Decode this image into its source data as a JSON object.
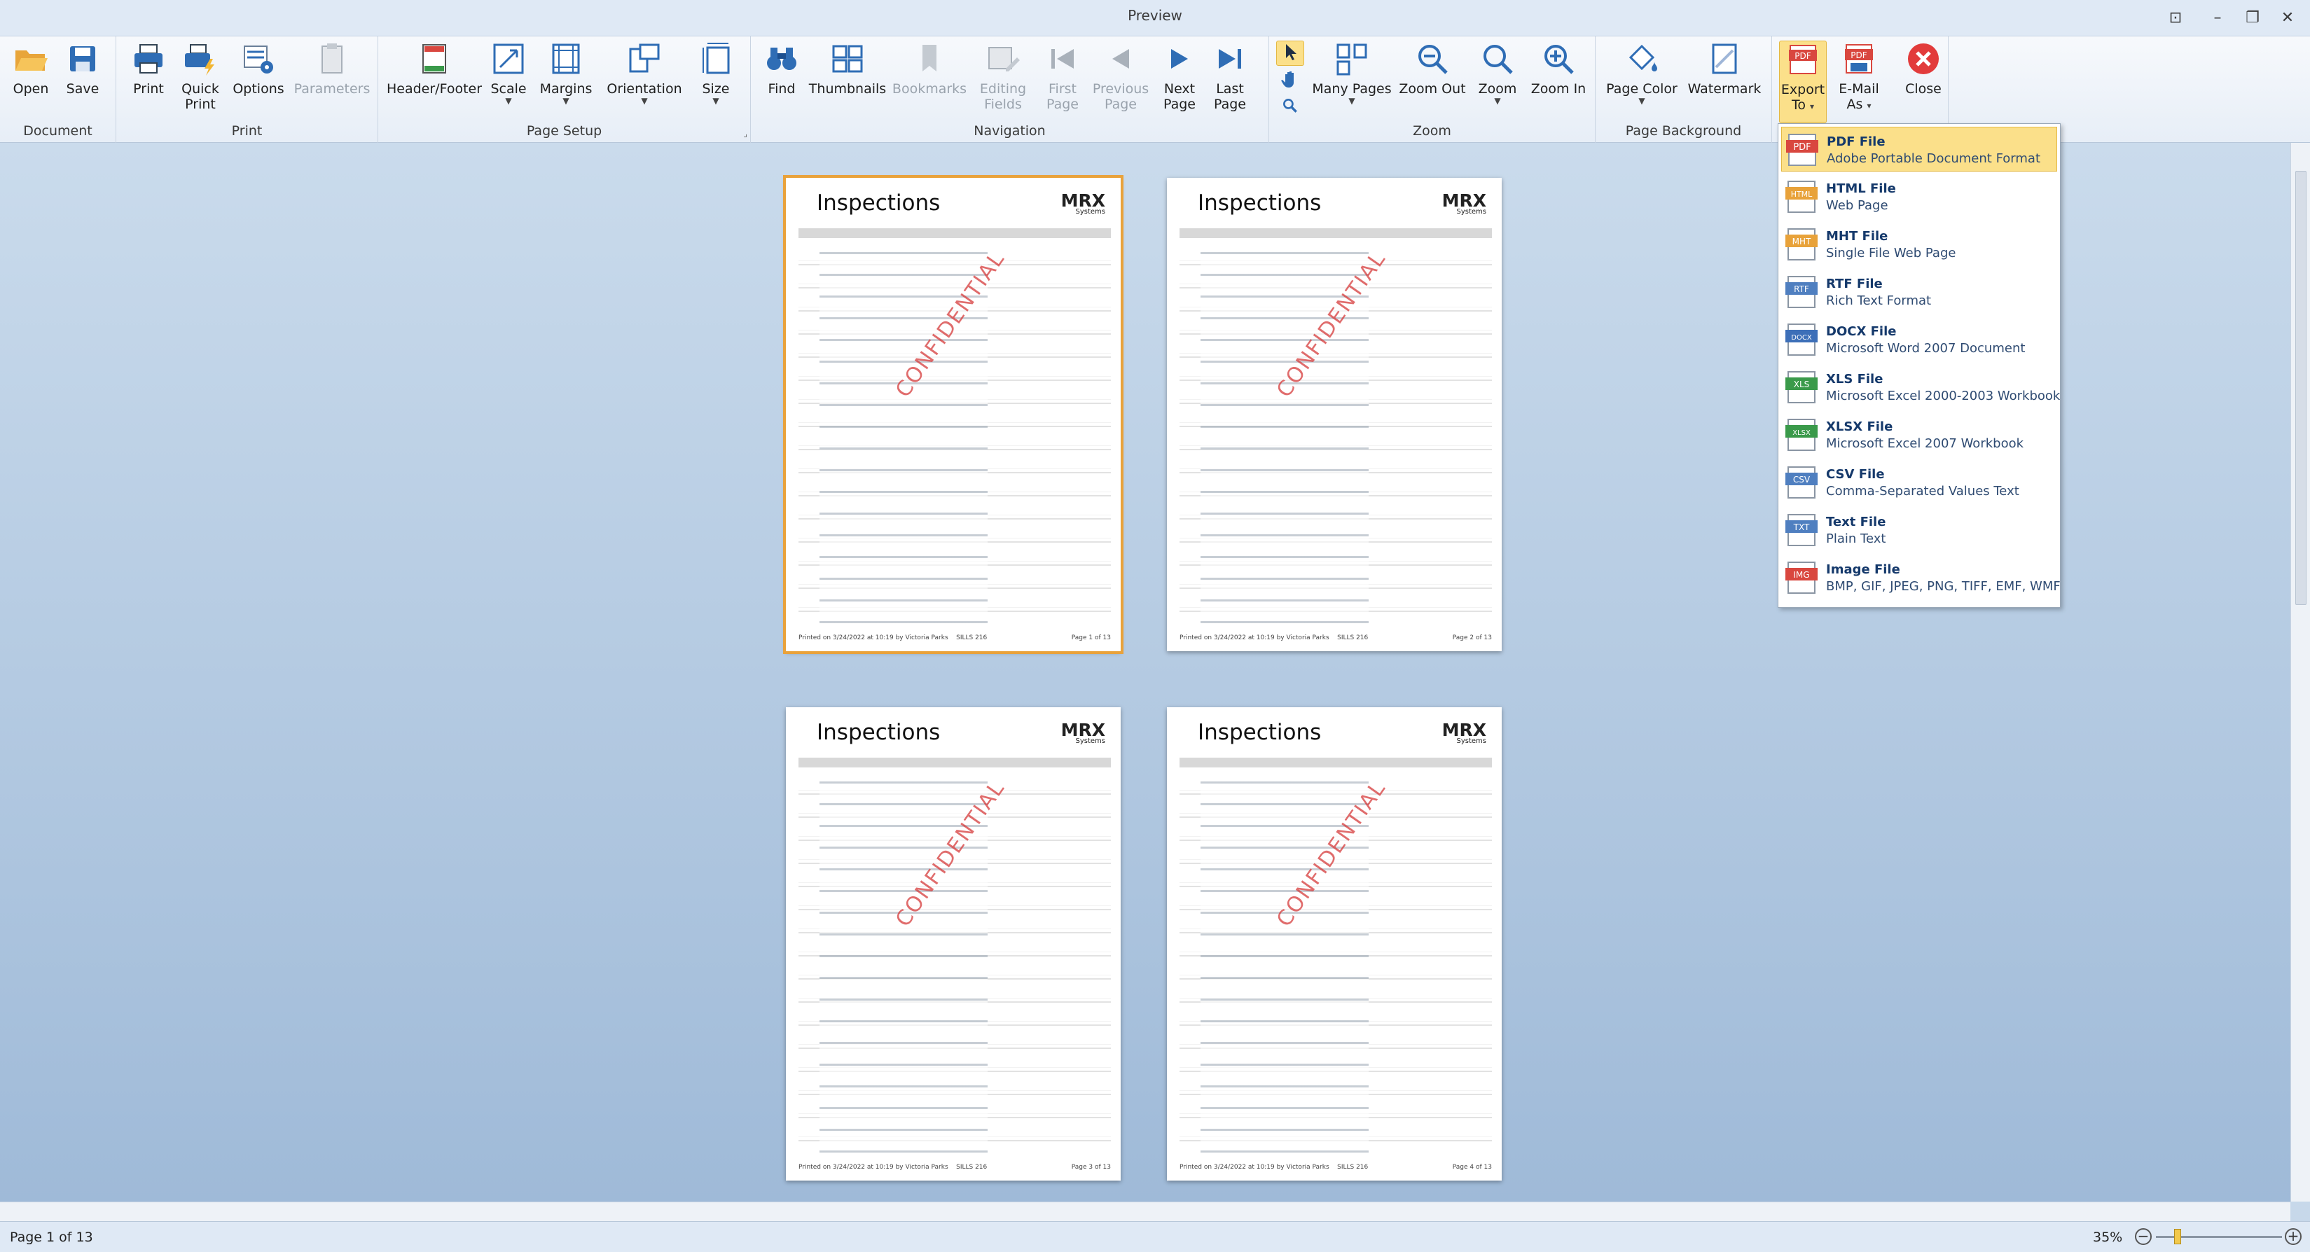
{
  "window": {
    "title": "Preview",
    "controls": [
      "⊡",
      "–",
      "❐",
      "✕"
    ]
  },
  "ribbon": {
    "groups": {
      "document": "Document",
      "print": "Print",
      "page_setup": "Page Setup",
      "navigation": "Navigation",
      "zoom": "Zoom",
      "page_background": "Page Background"
    },
    "buttons": {
      "open": "Open",
      "save": "Save",
      "print": "Print",
      "quick_print_1": "Quick",
      "quick_print_2": "Print",
      "options": "Options",
      "parameters": "Parameters",
      "header_footer": "Header/Footer",
      "scale": "Scale",
      "margins": "Margins",
      "orientation": "Orientation",
      "size": "Size",
      "find": "Find",
      "thumbnails": "Thumbnails",
      "bookmarks": "Bookmarks",
      "editing_fields_1": "Editing",
      "editing_fields_2": "Fields",
      "first_page_1": "First",
      "first_page_2": "Page",
      "previous_page_1": "Previous",
      "previous_page_2": "Page",
      "next_page_1": "Next",
      "next_page_2": "Page",
      "last_page_1": "Last",
      "last_page_2": "Page",
      "many_pages": "Many Pages",
      "zoom_out": "Zoom Out",
      "zoom": "Zoom",
      "zoom_in": "Zoom In",
      "page_color": "Page Color",
      "watermark": "Watermark",
      "export_to_1": "Export",
      "export_to_2": "To",
      "email_as_1": "E-Mail",
      "email_as_2": "As",
      "close": "Close"
    }
  },
  "pages": [
    {
      "title": "Inspections",
      "logo": "MRX",
      "logo_sub": "Systems",
      "watermark": "CONFIDENTIAL",
      "footer_left": "Printed on 3/24/2022 at 10:19 by Victoria Parks",
      "footer_mid": "SILLS 216",
      "footer_right": "Page 1 of 13"
    },
    {
      "title": "Inspections",
      "logo": "MRX",
      "logo_sub": "Systems",
      "watermark": "CONFIDENTIAL",
      "footer_left": "Printed on 3/24/2022 at 10:19 by Victoria Parks",
      "footer_mid": "SILLS 216",
      "footer_right": "Page 2 of 13"
    },
    {
      "title": "Inspections",
      "logo": "MRX",
      "logo_sub": "Systems",
      "watermark": "CONFIDENTIAL",
      "footer_left": "Printed on 3/24/2022 at 10:19 by Victoria Parks",
      "footer_mid": "SILLS 216",
      "footer_right": "Page 3 of 13"
    },
    {
      "title": "Inspections",
      "logo": "MRX",
      "logo_sub": "Systems",
      "watermark": "CONFIDENTIAL",
      "footer_left": "Printed on 3/24/2022 at 10:19 by Victoria Parks",
      "footer_mid": "SILLS 216",
      "footer_right": "Page 4 of 13"
    }
  ],
  "export_menu": [
    {
      "title": "PDF File",
      "subtitle": "Adobe Portable Document Format",
      "tag": "PDF",
      "color": "#d9473f"
    },
    {
      "title": "HTML File",
      "subtitle": "Web Page",
      "tag": "HTML",
      "color": "#e8a23a"
    },
    {
      "title": "MHT File",
      "subtitle": "Single File Web Page",
      "tag": "MHT",
      "color": "#e8a23a"
    },
    {
      "title": "RTF File",
      "subtitle": "Rich Text Format",
      "tag": "RTF",
      "color": "#4f7fc0"
    },
    {
      "title": "DOCX File",
      "subtitle": "Microsoft Word 2007 Document",
      "tag": "DOCX",
      "color": "#3d6fb8"
    },
    {
      "title": "XLS File",
      "subtitle": "Microsoft Excel 2000-2003 Workbook",
      "tag": "XLS",
      "color": "#3a9a4a"
    },
    {
      "title": "XLSX File",
      "subtitle": "Microsoft Excel 2007 Workbook",
      "tag": "XLSX",
      "color": "#3a9a4a"
    },
    {
      "title": "CSV File",
      "subtitle": "Comma-Separated Values Text",
      "tag": "CSV",
      "color": "#4f7fc0"
    },
    {
      "title": "Text File",
      "subtitle": "Plain Text",
      "tag": "TXT",
      "color": "#4f7fc0"
    },
    {
      "title": "Image File",
      "subtitle": "BMP, GIF, JPEG, PNG, TIFF, EMF, WMF",
      "tag": "IMG",
      "color": "#d9473f"
    }
  ],
  "status": {
    "page": "Page 1 of 13",
    "zoom": "35%"
  },
  "colors": {
    "accent": "#fbe08a",
    "icon_blue": "#2f6db5",
    "close_red": "#e23b3b"
  }
}
